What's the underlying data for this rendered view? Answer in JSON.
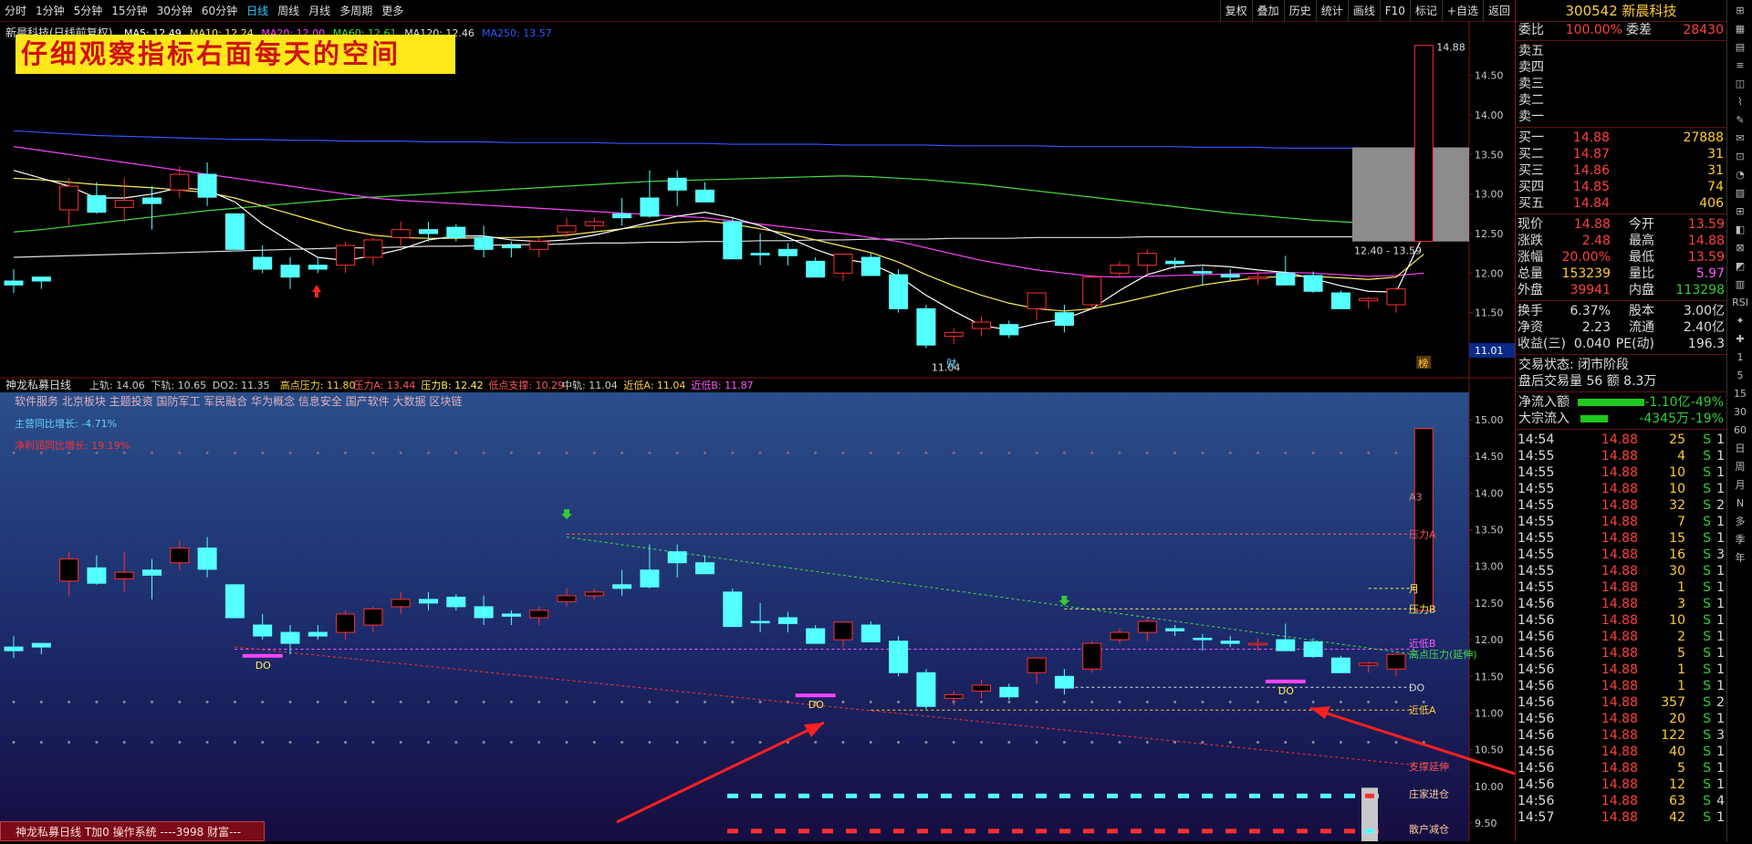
{
  "toolbar": {
    "tabs": [
      "分时",
      "1分钟",
      "5分钟",
      "15分钟",
      "30分钟",
      "60分钟",
      "日线",
      "周线",
      "月线",
      "多周期",
      "更多"
    ],
    "active": "日线",
    "right": [
      "复权",
      "叠加",
      "历史",
      "统计",
      "画线",
      "F10",
      "标记",
      "+自选",
      "返回"
    ]
  },
  "banner": "仔细观察指标右面每天的空间",
  "upper": {
    "title": "新晨科技(日线前复权)",
    "ma": [
      {
        "t": "MA5: 12.49",
        "c": "#ffffff"
      },
      {
        "t": "MA10: 12.24",
        "c": "#ffee55"
      },
      {
        "t": "MA20: 12.00",
        "c": "#ff44ff"
      },
      {
        "t": "MA60: 12.61",
        "c": "#44dd44"
      },
      {
        "t": "MA120: 12.46",
        "c": "#dddddd"
      },
      {
        "t": "MA250: 13.57",
        "c": "#3355ff"
      }
    ],
    "yticks": [
      "14.50",
      "14.00",
      "13.50",
      "13.00",
      "12.50",
      "12.00",
      "11.50"
    ],
    "high": "14.88",
    "low": "11.04",
    "range_label": "12.40 - 13.59",
    "current": "11.01",
    "fin_badge": "财",
    "bang_badge": "榜"
  },
  "lower": {
    "title": "神龙私募日线",
    "params": [
      {
        "t": "上轨: 14.06",
        "c": "#cccccc"
      },
      {
        "t": "下轨: 10.65",
        "c": "#cccccc"
      },
      {
        "t": "DO2: 11.35",
        "c": "#cccccc"
      },
      {
        "t": "高点压力: 11.80",
        "c": "#ffcc33"
      },
      {
        "t": "压力A: 13.44",
        "c": "#ff5555"
      },
      {
        "t": "压力B: 12.42",
        "c": "#ffee55"
      },
      {
        "t": "低点支撑: 10.29",
        "c": "#ff5555"
      },
      {
        "t": "中轨: 11.04",
        "c": "#cccccc"
      },
      {
        "t": "近低A: 11.04",
        "c": "#ffcc33"
      },
      {
        "t": "近低B: 11.87",
        "c": "#ff55ff"
      }
    ],
    "sectors": "软件服务 北京板块 主题投资 国防军工 军民融合 华为概念 信息安全 国产软件 大数据 区块链",
    "growth": "主营同比增长: -4.71%",
    "profit": "净利润同比增长: 19.19%",
    "yticks": [
      "15.00",
      "14.50",
      "14.00",
      "13.50",
      "13.00",
      "12.50",
      "12.00",
      "11.50",
      "11.00",
      "10.50",
      "10.00",
      "9.50"
    ],
    "labels": {
      "a3": "A3",
      "pa": "压力A",
      "pb": "压力B",
      "month": "月",
      "hp": "高点压力(延伸)",
      "jb": "近低B",
      "do": "DO",
      "ja": "近低A",
      "sup": "支撑延伸",
      "zj": "庄家进仓",
      "sh": "散户减仓",
      "do_mark": "DO"
    }
  },
  "footer": "神龙私募日线 T加0 操作系统 ----3998 财富---",
  "panel": {
    "title": "300542 新晨科技",
    "weibi": {
      "l": "委比",
      "v": "100.00%",
      "l2": "委差",
      "v2": "28430"
    },
    "sell": [
      "卖五",
      "卖四",
      "卖三",
      "卖二",
      "卖一"
    ],
    "buy": [
      {
        "l": "买一",
        "p": "14.88",
        "q": "27888"
      },
      {
        "l": "买二",
        "p": "14.87",
        "q": "31"
      },
      {
        "l": "买三",
        "p": "14.86",
        "q": "31"
      },
      {
        "l": "买四",
        "p": "14.85",
        "q": "74"
      },
      {
        "l": "买五",
        "p": "14.84",
        "q": "406"
      }
    ],
    "stats": [
      [
        "现价",
        "14.88",
        "今开",
        "13.59"
      ],
      [
        "涨跌",
        "2.48",
        "最高",
        "14.88"
      ],
      [
        "涨幅",
        "20.00%",
        "最低",
        "13.59"
      ],
      [
        "总量",
        "153239",
        "量比",
        "5.97"
      ],
      [
        "外盘",
        "39941",
        "内盘",
        "113298"
      ]
    ],
    "fin": [
      [
        "换手",
        "6.37%",
        "股本",
        "3.00亿"
      ],
      [
        "净资",
        "2.23",
        "流通",
        "2.40亿"
      ],
      [
        "收益(三)",
        "0.040",
        "PE(动)",
        "196.3"
      ]
    ],
    "state": "交易状态: 闭市阶段",
    "after": "盘后交易量 56 额 8.3万",
    "flow": [
      {
        "l": "净流入额",
        "v": "-1.10亿",
        "p": "-49%",
        "w": 95
      },
      {
        "l": "大宗流入",
        "v": "-4345万",
        "p": "-19%",
        "w": 38
      }
    ],
    "ticks": [
      [
        "14:54",
        "14.88",
        "25",
        "S",
        "1"
      ],
      [
        "14:55",
        "14.88",
        "4",
        "S",
        "1"
      ],
      [
        "14:55",
        "14.88",
        "10",
        "S",
        "1"
      ],
      [
        "14:55",
        "14.88",
        "10",
        "S",
        "1"
      ],
      [
        "14:55",
        "14.88",
        "32",
        "S",
        "2"
      ],
      [
        "14:55",
        "14.88",
        "7",
        "S",
        "1"
      ],
      [
        "14:55",
        "14.88",
        "15",
        "S",
        "1"
      ],
      [
        "14:55",
        "14.88",
        "16",
        "S",
        "3"
      ],
      [
        "14:55",
        "14.88",
        "30",
        "S",
        "1"
      ],
      [
        "14:55",
        "14.88",
        "1",
        "S",
        "1"
      ],
      [
        "14:56",
        "14.88",
        "3",
        "S",
        "1"
      ],
      [
        "14:56",
        "14.88",
        "10",
        "S",
        "1"
      ],
      [
        "14:56",
        "14.88",
        "2",
        "S",
        "1"
      ],
      [
        "14:56",
        "14.88",
        "5",
        "S",
        "1"
      ],
      [
        "14:56",
        "14.88",
        "1",
        "S",
        "1"
      ],
      [
        "14:56",
        "14.88",
        "1",
        "S",
        "1"
      ],
      [
        "14:56",
        "14.88",
        "357",
        "S",
        "2"
      ],
      [
        "14:56",
        "14.88",
        "20",
        "S",
        "1"
      ],
      [
        "14:56",
        "14.88",
        "122",
        "S",
        "3"
      ],
      [
        "14:56",
        "14.88",
        "40",
        "S",
        "1"
      ],
      [
        "14:56",
        "14.88",
        "5",
        "S",
        "1"
      ],
      [
        "14:56",
        "14.88",
        "12",
        "S",
        "1"
      ],
      [
        "14:56",
        "14.88",
        "63",
        "S",
        "4"
      ],
      [
        "14:57",
        "14.88",
        "42",
        "S",
        "1"
      ]
    ]
  },
  "tools": [
    "⊞",
    "▦",
    "▤",
    "≡",
    "◫",
    "⌇",
    "✎",
    "✉",
    "⊡",
    "◔",
    "▨",
    "⊞",
    "◧",
    "⊠",
    "◩",
    "▥",
    "RSI",
    "✦",
    "✚",
    "1",
    "5",
    "15",
    "30",
    "60",
    "日",
    "周",
    "月",
    "N",
    "多",
    "季",
    "年"
  ],
  "chart_data": {
    "type": "candlestick",
    "ylim_upper": [
      11.0,
      14.9
    ],
    "ylim_lower": [
      9.3,
      15.2
    ],
    "candles": [
      [
        11.9,
        12.05,
        11.75,
        11.85
      ],
      [
        11.95,
        11.95,
        11.8,
        11.9
      ],
      [
        12.8,
        13.2,
        12.6,
        13.1
      ],
      [
        12.98,
        13.15,
        12.75,
        12.77
      ],
      [
        12.83,
        13.2,
        12.65,
        12.92
      ],
      [
        12.95,
        13.1,
        12.55,
        12.88
      ],
      [
        13.05,
        13.35,
        12.95,
        13.25
      ],
      [
        13.25,
        13.4,
        12.85,
        12.96
      ],
      [
        12.75,
        12.75,
        12.3,
        12.3
      ],
      [
        12.2,
        12.35,
        12.0,
        12.05
      ],
      [
        12.1,
        12.2,
        11.8,
        11.95
      ],
      [
        12.1,
        12.2,
        12.0,
        12.05
      ],
      [
        12.1,
        12.4,
        12.0,
        12.35
      ],
      [
        12.2,
        12.45,
        12.1,
        12.42
      ],
      [
        12.45,
        12.65,
        12.35,
        12.55
      ],
      [
        12.55,
        12.65,
        12.4,
        12.5
      ],
      [
        12.58,
        12.62,
        12.4,
        12.45
      ],
      [
        12.45,
        12.6,
        12.2,
        12.3
      ],
      [
        12.35,
        12.4,
        12.2,
        12.32
      ],
      [
        12.3,
        12.45,
        12.2,
        12.4
      ],
      [
        12.52,
        12.7,
        12.45,
        12.6
      ],
      [
        12.6,
        12.7,
        12.55,
        12.65
      ],
      [
        12.75,
        12.95,
        12.6,
        12.7
      ],
      [
        12.95,
        13.3,
        12.7,
        12.72
      ],
      [
        13.2,
        13.3,
        12.85,
        13.05
      ],
      [
        13.05,
        13.15,
        12.9,
        12.9
      ],
      [
        12.65,
        12.7,
        12.18,
        12.18
      ],
      [
        12.25,
        12.5,
        12.1,
        12.23
      ],
      [
        12.3,
        12.38,
        12.1,
        12.22
      ],
      [
        12.15,
        12.2,
        11.95,
        11.95
      ],
      [
        12.0,
        12.25,
        11.9,
        12.24
      ],
      [
        12.2,
        12.25,
        11.98,
        11.97
      ],
      [
        11.98,
        12.05,
        11.5,
        11.55
      ],
      [
        11.55,
        11.6,
        11.05,
        11.09
      ],
      [
        11.2,
        11.3,
        11.1,
        11.25
      ],
      [
        11.3,
        11.45,
        11.2,
        11.38
      ],
      [
        11.35,
        11.4,
        11.18,
        11.22
      ],
      [
        11.55,
        11.75,
        11.4,
        11.75
      ],
      [
        11.5,
        11.6,
        11.25,
        11.34
      ],
      [
        11.6,
        11.98,
        11.55,
        11.95
      ],
      [
        12.0,
        12.15,
        11.95,
        12.1
      ],
      [
        12.1,
        12.3,
        11.98,
        12.25
      ],
      [
        12.15,
        12.2,
        12.05,
        12.12
      ],
      [
        12.02,
        12.08,
        11.85,
        12.0
      ],
      [
        11.98,
        12.05,
        11.9,
        11.95
      ],
      [
        11.93,
        12.02,
        11.85,
        11.95
      ],
      [
        12.0,
        12.22,
        11.85,
        11.85
      ],
      [
        11.97,
        12.02,
        11.75,
        11.77
      ],
      [
        11.75,
        11.78,
        11.55,
        11.55
      ],
      [
        11.65,
        11.7,
        11.55,
        11.68
      ],
      [
        11.6,
        11.82,
        11.5,
        11.8
      ],
      [
        12.4,
        14.88,
        12.4,
        14.88
      ]
    ],
    "ma_lines": [
      {
        "name": "MA250",
        "color": "#3355ff",
        "values": [
          13.8,
          13.78,
          13.76,
          13.74,
          13.73,
          13.72,
          13.71,
          13.7,
          13.69,
          13.69,
          13.68,
          13.68,
          13.67,
          13.67,
          13.67,
          13.66,
          13.66,
          13.66,
          13.65,
          13.65,
          13.65,
          13.65,
          13.64,
          13.64,
          13.64,
          13.64,
          13.63,
          13.63,
          13.63,
          13.63,
          13.62,
          13.62,
          13.62,
          13.62,
          13.61,
          13.61,
          13.61,
          13.61,
          13.6,
          13.6,
          13.6,
          13.6,
          13.6,
          13.59,
          13.59,
          13.59,
          13.58,
          13.58,
          13.58,
          13.58,
          13.57,
          13.57
        ]
      },
      {
        "name": "MA120",
        "color": "#dddddd",
        "values": [
          12.2,
          12.21,
          12.22,
          12.23,
          12.24,
          12.25,
          12.26,
          12.27,
          12.28,
          12.29,
          12.3,
          12.31,
          12.32,
          12.32,
          12.33,
          12.34,
          12.34,
          12.35,
          12.36,
          12.36,
          12.37,
          12.38,
          12.38,
          12.39,
          12.39,
          12.4,
          12.4,
          12.41,
          12.41,
          12.42,
          12.42,
          12.43,
          12.43,
          12.43,
          12.44,
          12.44,
          12.44,
          12.45,
          12.45,
          12.45,
          12.45,
          12.46,
          12.46,
          12.46,
          12.46,
          12.46,
          12.46,
          12.46,
          12.46,
          12.46,
          12.46,
          12.46
        ]
      },
      {
        "name": "MA60",
        "color": "#44dd44",
        "values": [
          12.52,
          12.55,
          12.59,
          12.63,
          12.67,
          12.71,
          12.75,
          12.79,
          12.82,
          12.85,
          12.88,
          12.91,
          12.94,
          12.96,
          12.98,
          13.0,
          13.02,
          13.04,
          13.06,
          13.08,
          13.1,
          13.12,
          13.14,
          13.16,
          13.17,
          13.18,
          13.19,
          13.2,
          13.21,
          13.22,
          13.23,
          13.22,
          13.2,
          13.18,
          13.15,
          13.12,
          13.08,
          13.04,
          13.0,
          12.96,
          12.92,
          12.88,
          12.84,
          12.8,
          12.76,
          12.73,
          12.7,
          12.67,
          12.65,
          12.63,
          12.62,
          12.61
        ]
      },
      {
        "name": "MA20",
        "color": "#ff44ff",
        "values": [
          13.6,
          13.55,
          13.5,
          13.45,
          13.4,
          13.35,
          13.3,
          13.25,
          13.2,
          13.15,
          13.1,
          13.05,
          13.0,
          12.95,
          12.92,
          12.9,
          12.88,
          12.86,
          12.84,
          12.82,
          12.8,
          12.78,
          12.76,
          12.74,
          12.72,
          12.7,
          12.66,
          12.62,
          12.58,
          12.54,
          12.5,
          12.45,
          12.4,
          12.32,
          12.24,
          12.16,
          12.1,
          12.04,
          12.0,
          11.96,
          11.95,
          11.96,
          11.97,
          11.98,
          11.99,
          12.0,
          12.01,
          12.0,
          11.98,
          11.96,
          11.97,
          12.0
        ]
      },
      {
        "name": "MA10",
        "color": "#ffee55",
        "values": [
          13.2,
          13.18,
          13.15,
          13.12,
          13.1,
          13.08,
          13.05,
          13.02,
          12.95,
          12.85,
          12.75,
          12.65,
          12.55,
          12.48,
          12.45,
          12.44,
          12.44,
          12.45,
          12.45,
          12.46,
          12.48,
          12.52,
          12.56,
          12.6,
          12.64,
          12.66,
          12.62,
          12.56,
          12.5,
          12.42,
          12.34,
          12.26,
          12.14,
          11.98,
          11.84,
          11.72,
          11.62,
          11.55,
          11.52,
          11.55,
          11.62,
          11.7,
          11.78,
          11.85,
          11.9,
          11.94,
          11.96,
          11.96,
          11.94,
          11.92,
          11.95,
          12.24
        ]
      },
      {
        "name": "MA5",
        "color": "#ffffff",
        "values": [
          13.3,
          13.2,
          13.1,
          12.95,
          12.95,
          13.0,
          13.08,
          13.05,
          12.9,
          12.62,
          12.4,
          12.2,
          12.16,
          12.22,
          12.3,
          12.42,
          12.47,
          12.47,
          12.42,
          12.4,
          12.42,
          12.48,
          12.56,
          12.64,
          12.72,
          12.77,
          12.7,
          12.6,
          12.45,
          12.3,
          12.18,
          12.12,
          11.96,
          11.72,
          11.52,
          11.34,
          11.28,
          11.36,
          11.42,
          11.55,
          11.78,
          11.98,
          12.08,
          12.1,
          12.08,
          12.04,
          12.01,
          11.93,
          11.84,
          11.77,
          11.76,
          12.49
        ]
      }
    ]
  }
}
